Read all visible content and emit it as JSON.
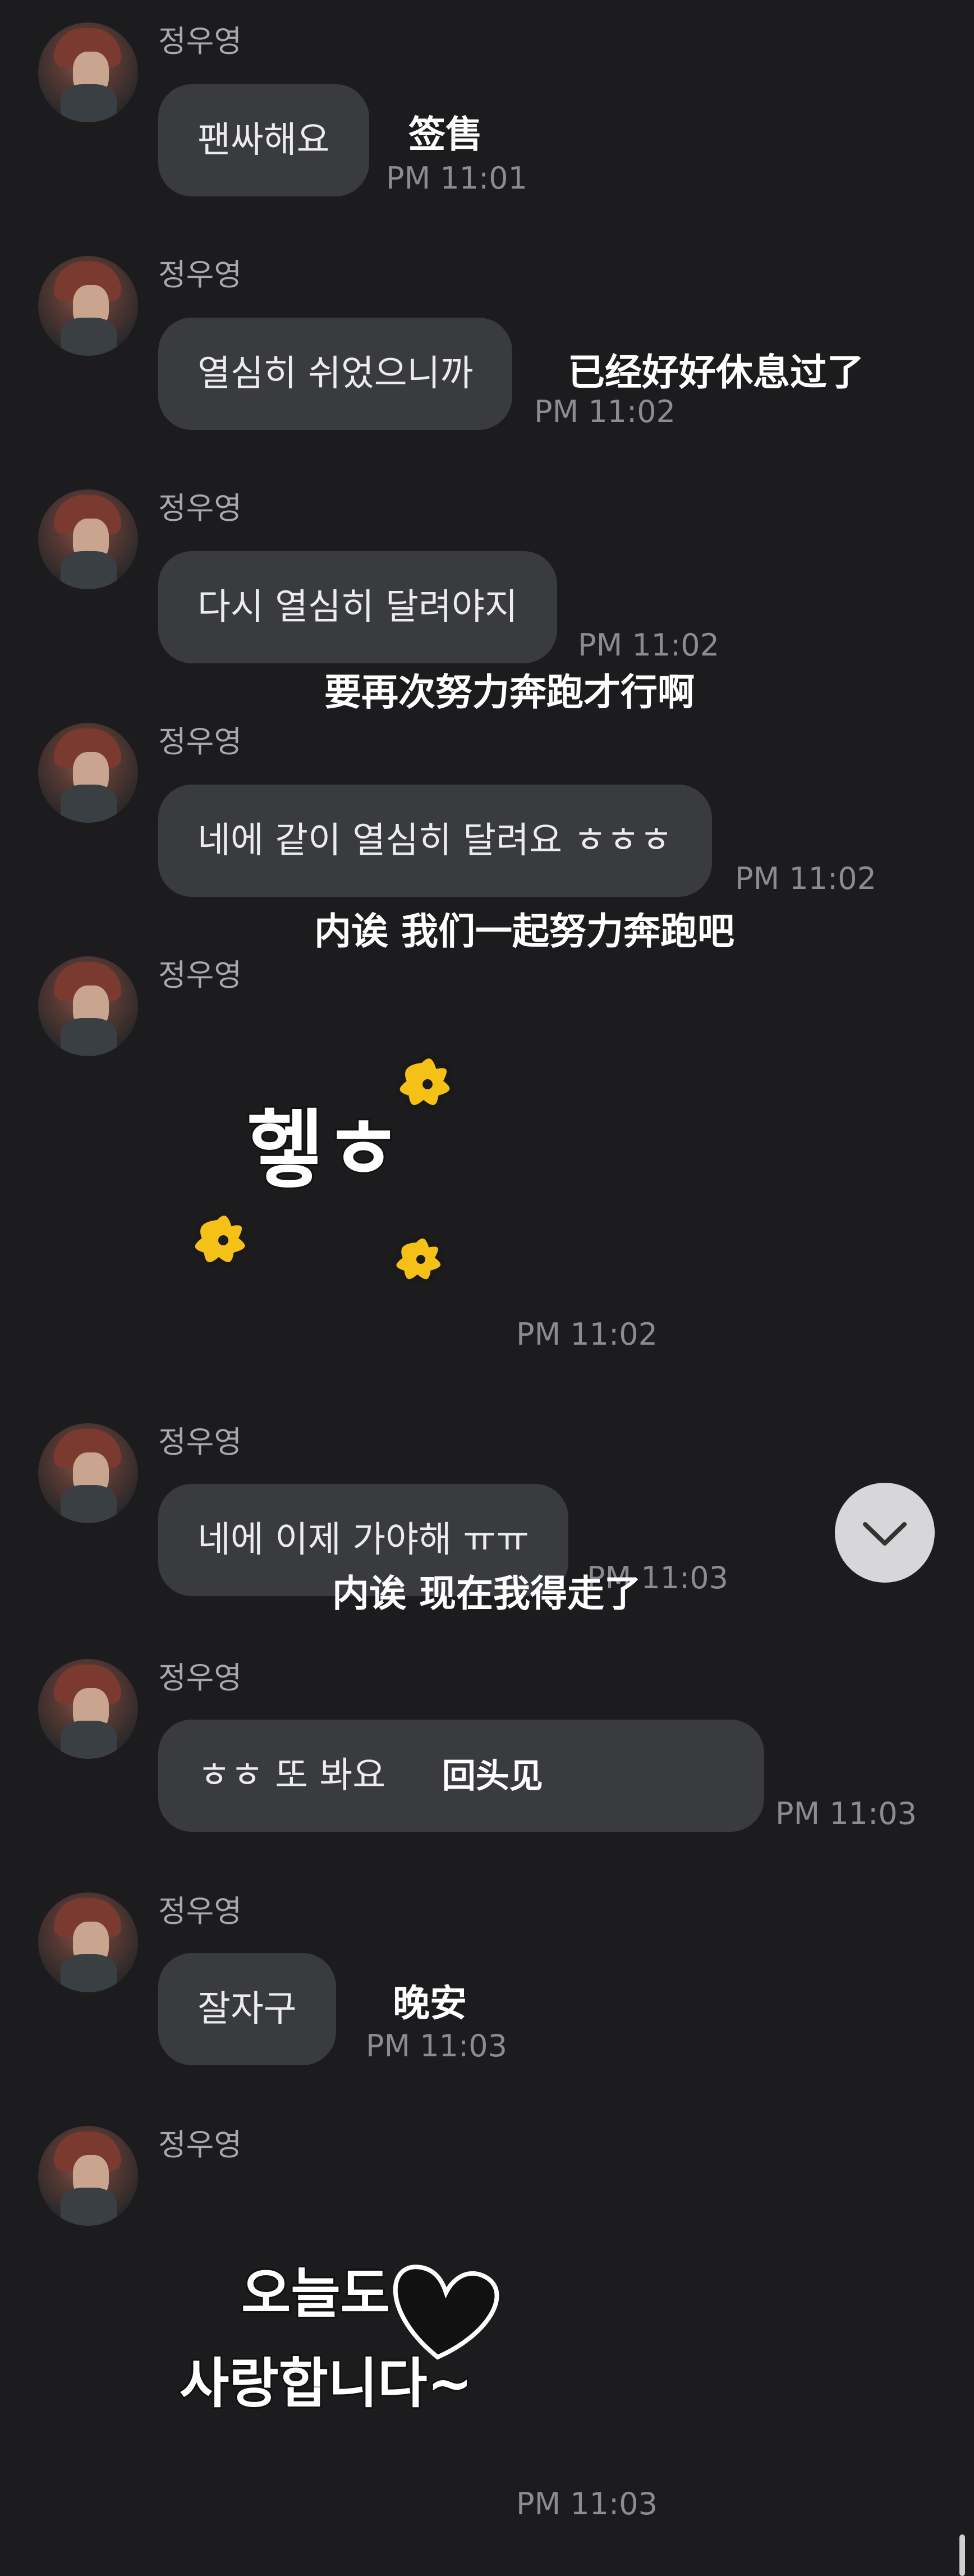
{
  "sender": {
    "name": "정우영"
  },
  "messages": [
    {
      "text": "팬싸해요",
      "time": "PM 11:01",
      "translation": "签售"
    },
    {
      "text": "열심히 쉬었으니까",
      "time": "PM 11:02",
      "translation": "已经好好休息过了"
    },
    {
      "text": "다시 열심히 달려야지",
      "time": "PM 11:02",
      "translation": "要再次努力奔跑才行啊"
    },
    {
      "text": "네에 같이 열심히 달려요 ㅎㅎㅎ",
      "time": "PM 11:02",
      "translation": "内诶 我们一起努力奔跑吧"
    },
    {
      "sticker_text": "헿ㅎ",
      "time": "PM 11:02"
    },
    {
      "text": "네에 이제 가야해 ㅠㅠ",
      "time": "PM 11:03",
      "translation": "内诶 现在我得走了"
    },
    {
      "text": "ㅎㅎ 또 봐요",
      "time": "PM 11:03",
      "translation": "回头见"
    },
    {
      "text": "잘자구",
      "time": "PM 11:03",
      "translation": "晚安"
    },
    {
      "sticker_text": "오늘도 사랑합니다~",
      "time": "PM 11:03"
    }
  ],
  "icons": {
    "scroll_down": "chevron-down-icon",
    "sticker_heart": "heart-icon",
    "sticker_sparkle": "sparkle-icon"
  },
  "colors": {
    "background": "#1c1c1e",
    "bubble": "#3a3b3f",
    "sparkle": "#f5c116"
  }
}
